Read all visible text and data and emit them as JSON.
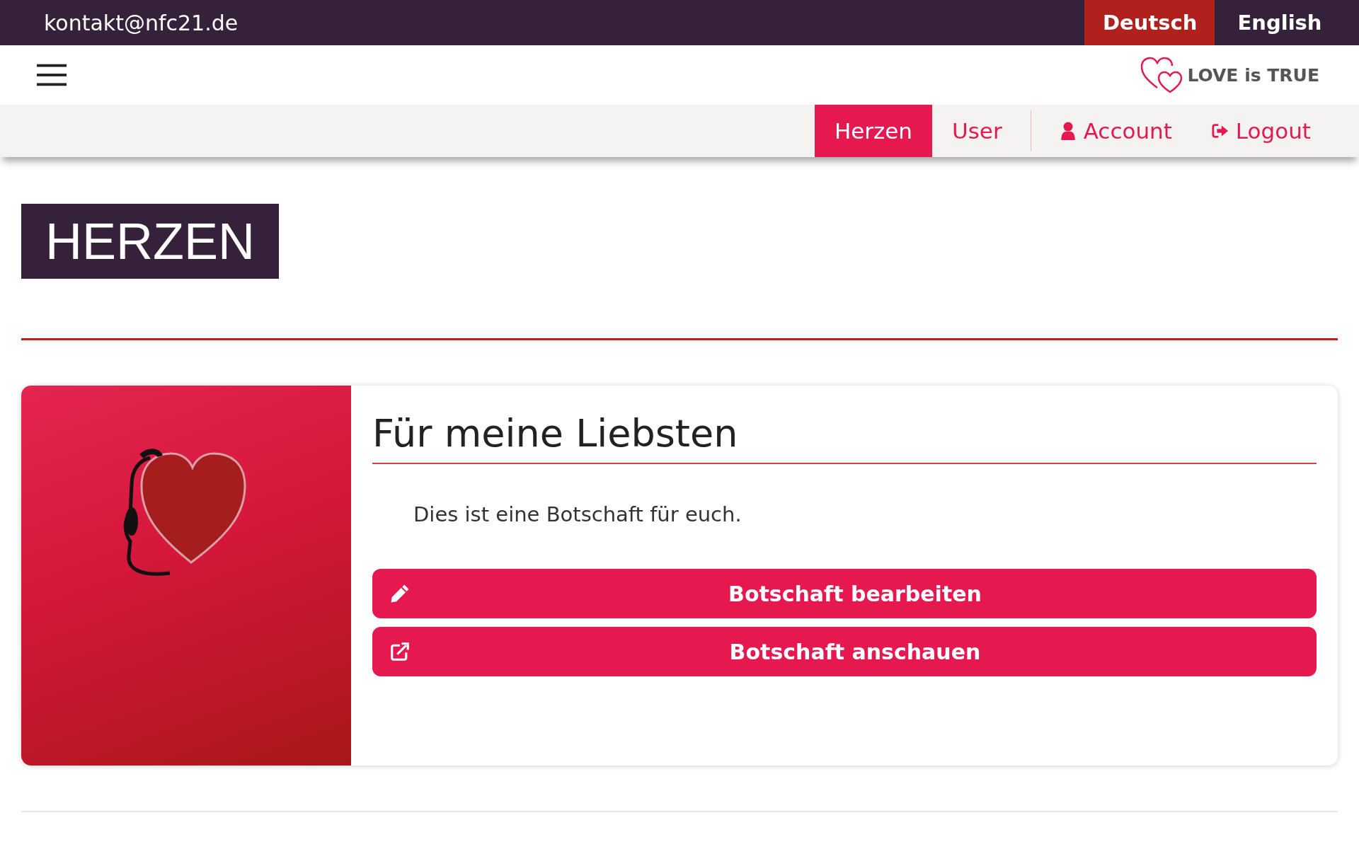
{
  "top_bar": {
    "email": "kontakt@nfc21.de",
    "languages": [
      {
        "label": "Deutsch",
        "selected": true
      },
      {
        "label": "English",
        "selected": false
      }
    ]
  },
  "header": {
    "logo_text": "LOVE is TRUE"
  },
  "nav": [
    {
      "label": "Herzen",
      "kind": "plain",
      "selected": true
    },
    {
      "label": "User",
      "kind": "plain",
      "selected": false
    },
    {
      "label": "Account",
      "kind": "account",
      "selected": false
    },
    {
      "label": "Logout",
      "kind": "logout",
      "selected": false
    }
  ],
  "page_title": "HERZEN",
  "card": {
    "title": "Für meine Liebsten",
    "message": "Dies ist eine Botschaft für euch.",
    "buttons": [
      {
        "label": "Botschaft bearbeiten",
        "kind": "edit"
      },
      {
        "label": "Botschaft anschauen",
        "kind": "open"
      }
    ]
  }
}
